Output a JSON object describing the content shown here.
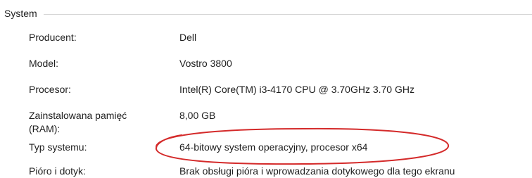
{
  "section": {
    "title": "System"
  },
  "rows": [
    {
      "label": "Producent:",
      "value": "Dell"
    },
    {
      "label": "Model:",
      "value": "Vostro 3800"
    },
    {
      "label": "Procesor:",
      "value": "Intel(R) Core(TM) i3-4170 CPU @ 3.70GHz   3.70 GHz"
    },
    {
      "label": "Zainstalowana pamięć (RAM):",
      "value": "8,00 GB"
    },
    {
      "label": "Typ systemu:",
      "value": "64-bitowy system operacyjny, procesor x64"
    },
    {
      "label": "Pióro i dotyk:",
      "value": "Brak obsługi pióra i wprowadzania dotykowego dla tego ekranu"
    }
  ],
  "colors": {
    "annotation_ellipse": "#d42a2a",
    "divider": "#d6d6d6"
  }
}
